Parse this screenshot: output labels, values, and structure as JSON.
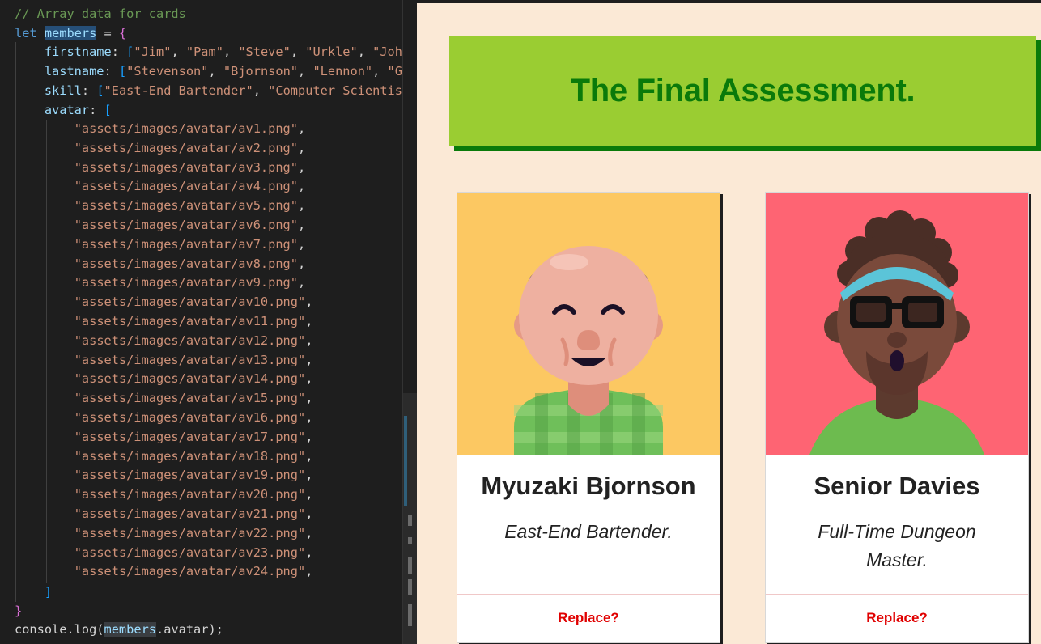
{
  "editor": {
    "comment": "// Array data for cards",
    "kw_let": "let",
    "var_members": "members",
    "op_assign": " = ",
    "brace_open": "{",
    "brace_close": "}",
    "firstname_key": "firstname",
    "firstname_values": [
      "\"Jim\"",
      "\"Pam\"",
      "\"Steve\"",
      "\"Urkle\"",
      "\"Joh"
    ],
    "lastname_key": "lastname",
    "lastname_values": [
      "\"Stevenson\"",
      "\"Bjornson\"",
      "\"Lennon\"",
      "\"G"
    ],
    "skill_key": "skill",
    "skill_values": [
      "\"East-End Bartender\"",
      "\"Computer Scientis"
    ],
    "avatar_key": "avatar",
    "avatar_paths": [
      "\"assets/images/avatar/av1.png\"",
      "\"assets/images/avatar/av2.png\"",
      "\"assets/images/avatar/av3.png\"",
      "\"assets/images/avatar/av4.png\"",
      "\"assets/images/avatar/av5.png\"",
      "\"assets/images/avatar/av6.png\"",
      "\"assets/images/avatar/av7.png\"",
      "\"assets/images/avatar/av8.png\"",
      "\"assets/images/avatar/av9.png\"",
      "\"assets/images/avatar/av10.png\"",
      "\"assets/images/avatar/av11.png\"",
      "\"assets/images/avatar/av12.png\"",
      "\"assets/images/avatar/av13.png\"",
      "\"assets/images/avatar/av14.png\"",
      "\"assets/images/avatar/av15.png\"",
      "\"assets/images/avatar/av16.png\"",
      "\"assets/images/avatar/av17.png\"",
      "\"assets/images/avatar/av18.png\"",
      "\"assets/images/avatar/av19.png\"",
      "\"assets/images/avatar/av20.png\"",
      "\"assets/images/avatar/av21.png\"",
      "\"assets/images/avatar/av22.png\"",
      "\"assets/images/avatar/av23.png\"",
      "\"assets/images/avatar/av24.png\""
    ],
    "bracket_close": "]",
    "console_prefix": "console.log(",
    "console_members": "members",
    "console_suffix": ".avatar);"
  },
  "preview": {
    "hero_title": "The Final Assessment.",
    "cards": [
      {
        "name": "Myuzaki Bjornson",
        "skill": "East-End Bartender.",
        "button": "Replace?",
        "avatar_bg": "#fcc862",
        "avatar_icon": "bald-man-avatar-icon"
      },
      {
        "name": "Senior Davies",
        "skill": "Full-Time Dungeon Master.",
        "button": "Replace?",
        "avatar_bg": "#fe6473",
        "avatar_icon": "headband-man-avatar-icon"
      }
    ]
  },
  "colors": {
    "hero_bg": "#9acd32",
    "hero_text": "#0a7a0a",
    "page_bg": "#fbe9d6",
    "button_text": "#e00000"
  }
}
